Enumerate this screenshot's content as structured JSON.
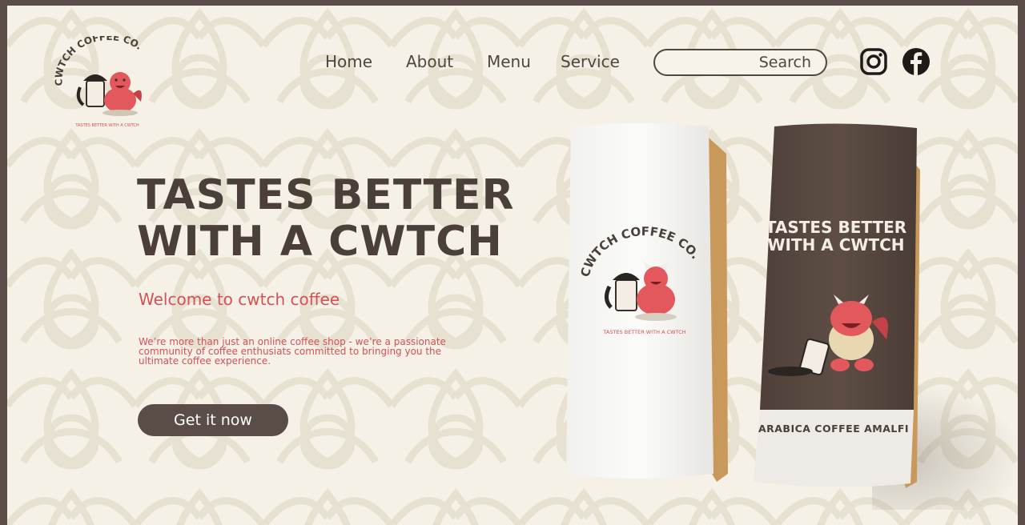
{
  "brand": {
    "name": "CWTCH COFFEE CO.",
    "tagline": "TASTES BETTER WITH A CWTCH"
  },
  "nav": {
    "items": [
      {
        "label": "Home"
      },
      {
        "label": "About"
      },
      {
        "label": "Menu"
      },
      {
        "label": "Service"
      }
    ],
    "search_placeholder": "Search"
  },
  "social": {
    "instagram_icon": "instagram-icon",
    "facebook_icon": "facebook-icon"
  },
  "hero": {
    "headline_line1": "TASTES BETTER",
    "headline_line2": "WITH A CWTCH",
    "welcome": "Welcome to cwtch coffee",
    "description": "We’re more than just an online coffee shop - we’re  a passionate community of coffee enthusiats committed to bringing you the ultimate coffee experience.",
    "cta_label": "Get it now"
  },
  "products": {
    "white_bag": {
      "brand": "CWTCH COFFEE CO.",
      "tagline": "TASTES BETTER WITH A CWTCH"
    },
    "dark_bag": {
      "tagline_line1": "TASTES BETTER",
      "tagline_line2": "WITH A CWTCH",
      "label": "ARABICA COFFEE AMALFI"
    }
  },
  "colors": {
    "background": "#f5f1e7",
    "frame": "#5a4d47",
    "text_dark": "#4a3f39",
    "accent_red": "#d45056",
    "button": "#5a4d47"
  }
}
